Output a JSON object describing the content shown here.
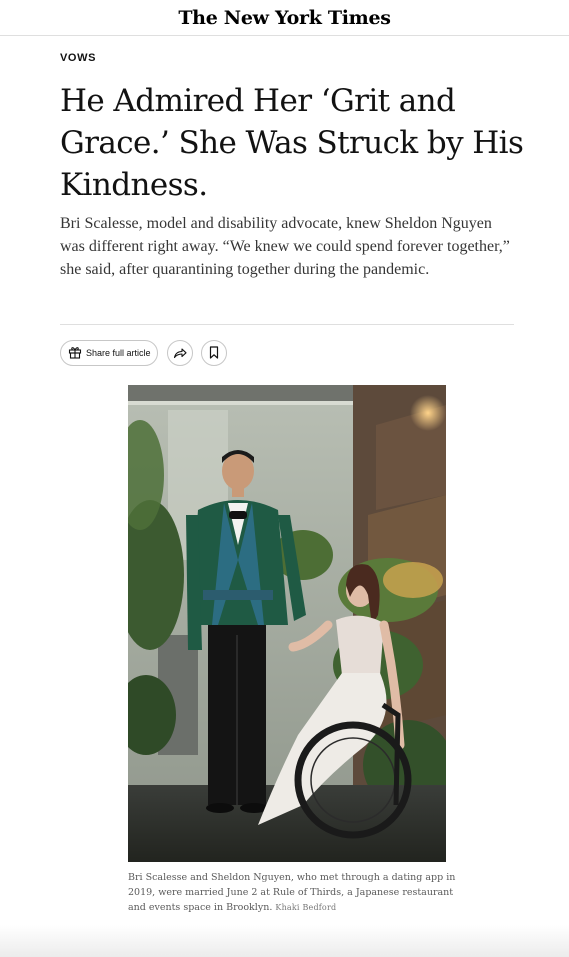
{
  "masthead": {
    "logo_text": "The New York Times"
  },
  "article": {
    "kicker": "VOWS",
    "headline": "He Admired Her ‘Grit and Grace.’ She Was Struck by His Kindness.",
    "summary": "Bri Scalesse, model and disability advocate, knew Sheldon Nguyen was different right away. “We knew we could spend forever together,” she said, after quarantining together during the pandemic."
  },
  "actions": {
    "share_label": "Share full article",
    "share_icon": "gift-icon",
    "forward_icon": "share-arrow-icon",
    "save_icon": "bookmark-icon"
  },
  "photo": {
    "caption": "Bri Scalesse and Sheldon Nguyen, who met through a dating app in 2019, were married June 2 at Rule of Thirds, a Japanese restaurant and events space in Brooklyn.",
    "credit": "Khaki Bedford"
  }
}
